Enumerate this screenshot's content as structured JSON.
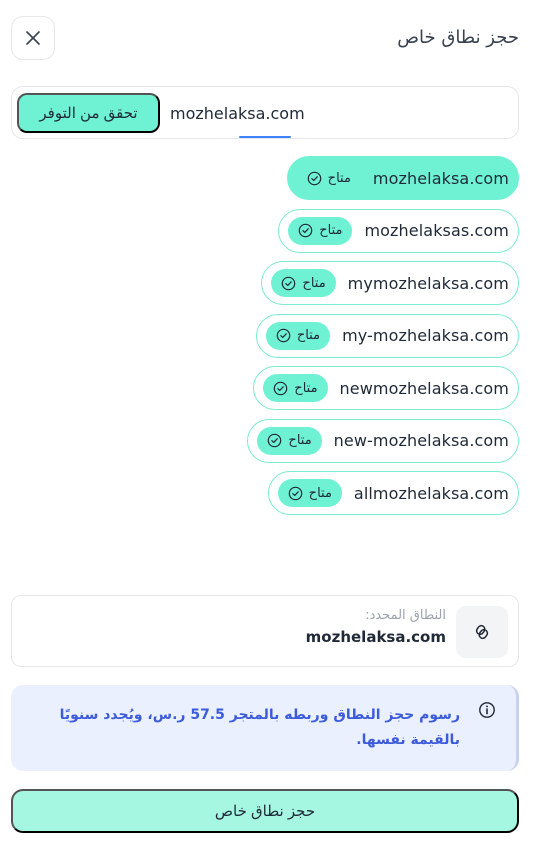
{
  "header": {
    "title": "حجز نطاق خاص",
    "close_icon": "close-icon"
  },
  "search": {
    "value": "mozhelaksa.com",
    "button_label": "تحقق من التوفر"
  },
  "results": [
    {
      "domain": "mozhelaksa.com",
      "status": "متاح",
      "selected": true
    },
    {
      "domain": "mozhelaksas.com",
      "status": "متاح",
      "selected": false
    },
    {
      "domain": "mymozhelaksa.com",
      "status": "متاح",
      "selected": false
    },
    {
      "domain": "my-mozhelaksa.com",
      "status": "متاح",
      "selected": false
    },
    {
      "domain": "newmozhelaksa.com",
      "status": "متاح",
      "selected": false
    },
    {
      "domain": "new-mozhelaksa.com",
      "status": "متاح",
      "selected": false
    },
    {
      "domain": "allmozhelaksa.com",
      "status": "متاح",
      "selected": false
    }
  ],
  "selected_domain": {
    "label": "النطاق المحدد:",
    "value": "mozhelaksa.com",
    "icon": "link-icon"
  },
  "info": {
    "text": "رسوم حجز النطاق وربطه بالمتجر 57.5 ر.س، ويُجدد سنويًا بالقيمة نفسها.",
    "icon": "info-icon"
  },
  "reserve_button_label": "حجز نطاق خاص",
  "colors": {
    "accent": "#6ff2d3",
    "accent_light": "#a5f7e1",
    "chip_border": "#7cebcf",
    "info_bg": "#eaf0fe",
    "info_text": "#3b5bdb"
  }
}
